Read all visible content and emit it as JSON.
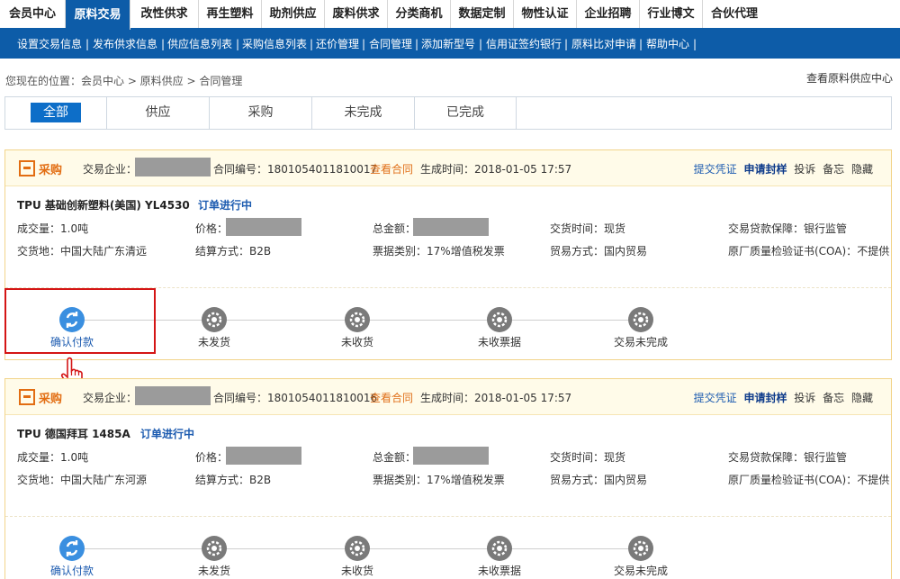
{
  "top_nav": [
    "会员中心",
    "原料交易",
    "改性供求",
    "再生塑料",
    "助剂供应",
    "废料供求",
    "分类商机",
    "数据定制",
    "物性认证",
    "企业招聘",
    "行业博文",
    "合伙代理"
  ],
  "sub_nav": [
    "设置交易信息",
    "发布供求信息",
    "供应信息列表",
    "采购信息列表",
    "还价管理",
    "合同管理",
    "添加新型号",
    "信用证签约银行",
    "原料比对申请",
    "帮助中心"
  ],
  "breadcrumb": "您现在的位置：会员中心 > 原料供应 > 合同管理",
  "supplier_center": "查看原料供应中心",
  "tabs": [
    "全部",
    "供应",
    "采购",
    "未完成",
    "已完成"
  ],
  "common": {
    "badge": "采购",
    "company_label": "交易企业：",
    "contract_no_label": "合同编号：",
    "view_contract": "查看合同",
    "created_label": "生成时间：",
    "actions": [
      "提交凭证",
      "申请封样",
      "投诉",
      "备忘",
      "隐藏"
    ],
    "volume_label": "成交量：",
    "price_label": "价格：",
    "total_label": "总金额：",
    "delivery_time_label": "交货时间：",
    "guarantee_label": "交易贷款保障：",
    "place_label": "交货地：",
    "settle_label": "结算方式：",
    "invoice_label": "票据类别：",
    "trade_label": "贸易方式：",
    "coa_label": "原厂质量检验证书(COA)："
  },
  "orders": [
    {
      "contract_no": "1801054011810017",
      "created": "2018-01-05 17:57",
      "product": "TPU 基础创新塑料(美国) YL4530",
      "status": "订单进行中",
      "volume": "1.0吨",
      "delivery_time": "现货",
      "guarantee": "银行监管",
      "place": "中国大陆广东清远",
      "settle": "B2B",
      "invoice": "17%增值税发票",
      "trade": "国内贸易",
      "coa": "不提供"
    },
    {
      "contract_no": "1801054011810016",
      "created": "2018-01-05 17:57",
      "product": "TPU 德国拜耳 1485A",
      "status": "订单进行中",
      "volume": "1.0吨",
      "delivery_time": "现货",
      "guarantee": "银行监管",
      "place": "中国大陆广东河源",
      "settle": "B2B",
      "invoice": "17%增值税发票",
      "trade": "国内贸易",
      "coa": "不提供"
    }
  ],
  "steps": [
    "确认付款",
    "未发货",
    "未收货",
    "未收票据",
    "交易未完成"
  ],
  "colors": {
    "primary": "#0d5ca8",
    "accent": "#e26d12",
    "link": "#1c5bb0",
    "highlight": "#d41515"
  }
}
